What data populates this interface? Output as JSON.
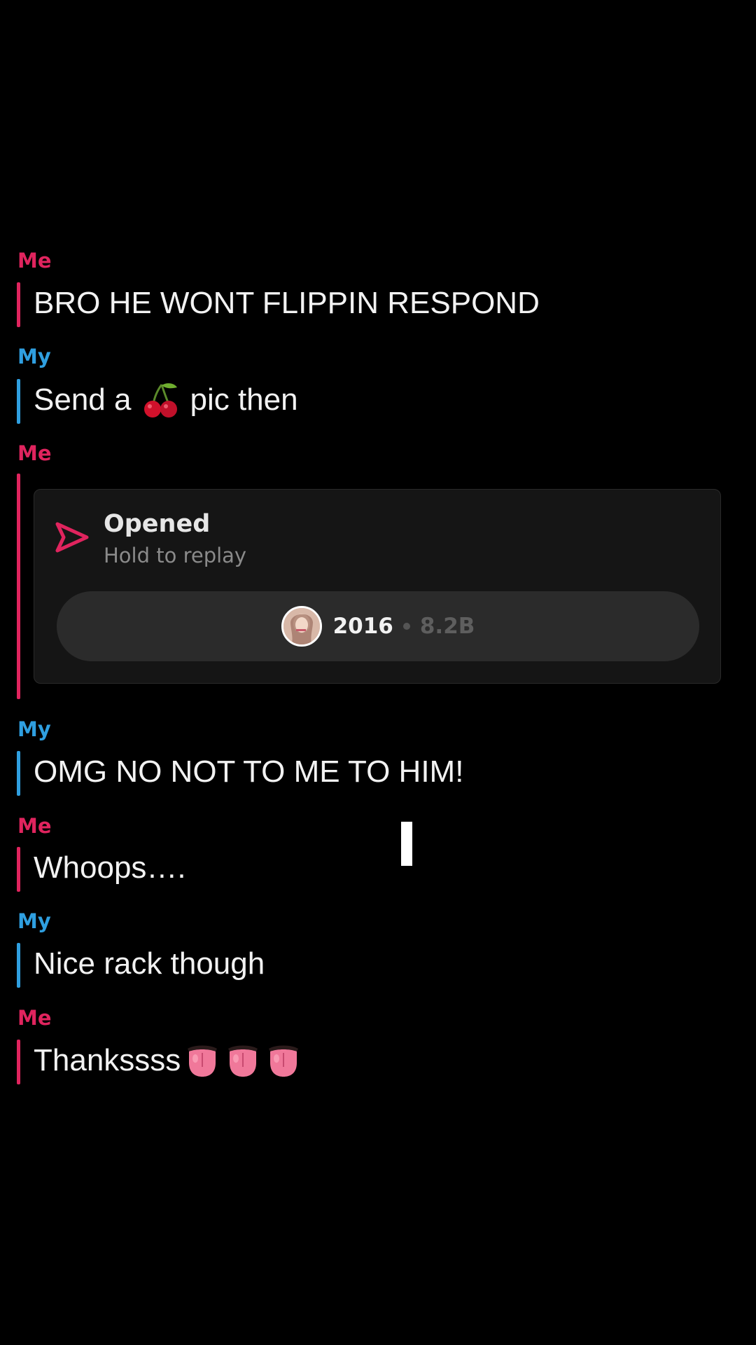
{
  "messages": [
    {
      "sender": "Me",
      "text": "BRO HE WONT FLIPPIN RESPOND"
    },
    {
      "sender": "My",
      "text_before": "Send a",
      "emoji": "cherry-icon",
      "text_after": "pic then"
    },
    {
      "sender": "Me",
      "type": "snap"
    },
    {
      "sender": "My",
      "text": "OMG NO NOT TO ME TO HIM!"
    },
    {
      "sender": "Me",
      "text": "Whoops…."
    },
    {
      "sender": "My",
      "text": "Nice rack though"
    },
    {
      "sender": "Me",
      "text": "Thankssss",
      "emoji": "tongue-icon",
      "emoji_count": 3
    }
  ],
  "snap": {
    "status": "Opened",
    "hint": "Hold to replay",
    "story_year": "2016",
    "story_views": "8.2B"
  },
  "colors": {
    "me": "#e0245e",
    "my": "#2f9fe0",
    "background": "#000000"
  }
}
